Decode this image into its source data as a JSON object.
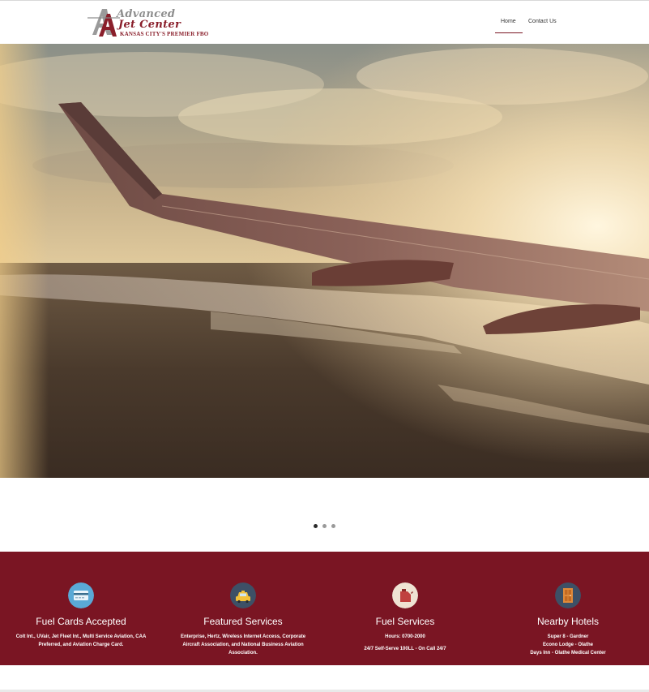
{
  "brand": {
    "name_line1": "Advanced",
    "name_line2": "Jet Center",
    "tagline": "KANSAS CITY'S PREMIER FBO",
    "mark_text": "Jet Center"
  },
  "nav": {
    "items": [
      {
        "label": "Home",
        "active": true
      },
      {
        "label": "Contact Us",
        "active": false
      }
    ]
  },
  "carousel": {
    "slide_count": 3,
    "active_index": 0
  },
  "features": [
    {
      "icon": "credit-card-icon",
      "title": "Fuel Cards Accepted",
      "lines": [
        "Colt Int., UVair, Jet Fleet Int., Multi Service Aviation, CAA Preferred, and Aviation Charge Card."
      ]
    },
    {
      "icon": "taxi-icon",
      "title": "Featured Services",
      "lines": [
        "Enterprise, Hertz, Wireless Internet Access, Corporate Aircraft Association, and National Business Aviation Association."
      ]
    },
    {
      "icon": "fuel-can-icon",
      "title": "Fuel Services",
      "lines": [
        "Hours: 0700-2000",
        "",
        "24/7 Self-Serve 100LL - On Call 24/7"
      ]
    },
    {
      "icon": "hotel-door-icon",
      "title": "Nearby Hotels",
      "lines": [
        "Super 8 - Gardner",
        "Econo Lodge - Olathe",
        "Days Inn - Olathe Medical Center"
      ]
    }
  ],
  "colors": {
    "brand_red": "#7a1523",
    "card_icon_bg": "#5aa9d6",
    "taxi_icon_bg": "#3d5066",
    "fuel_icon_bg": "#efe3d3",
    "hotel_icon_bg": "#3d5066"
  }
}
